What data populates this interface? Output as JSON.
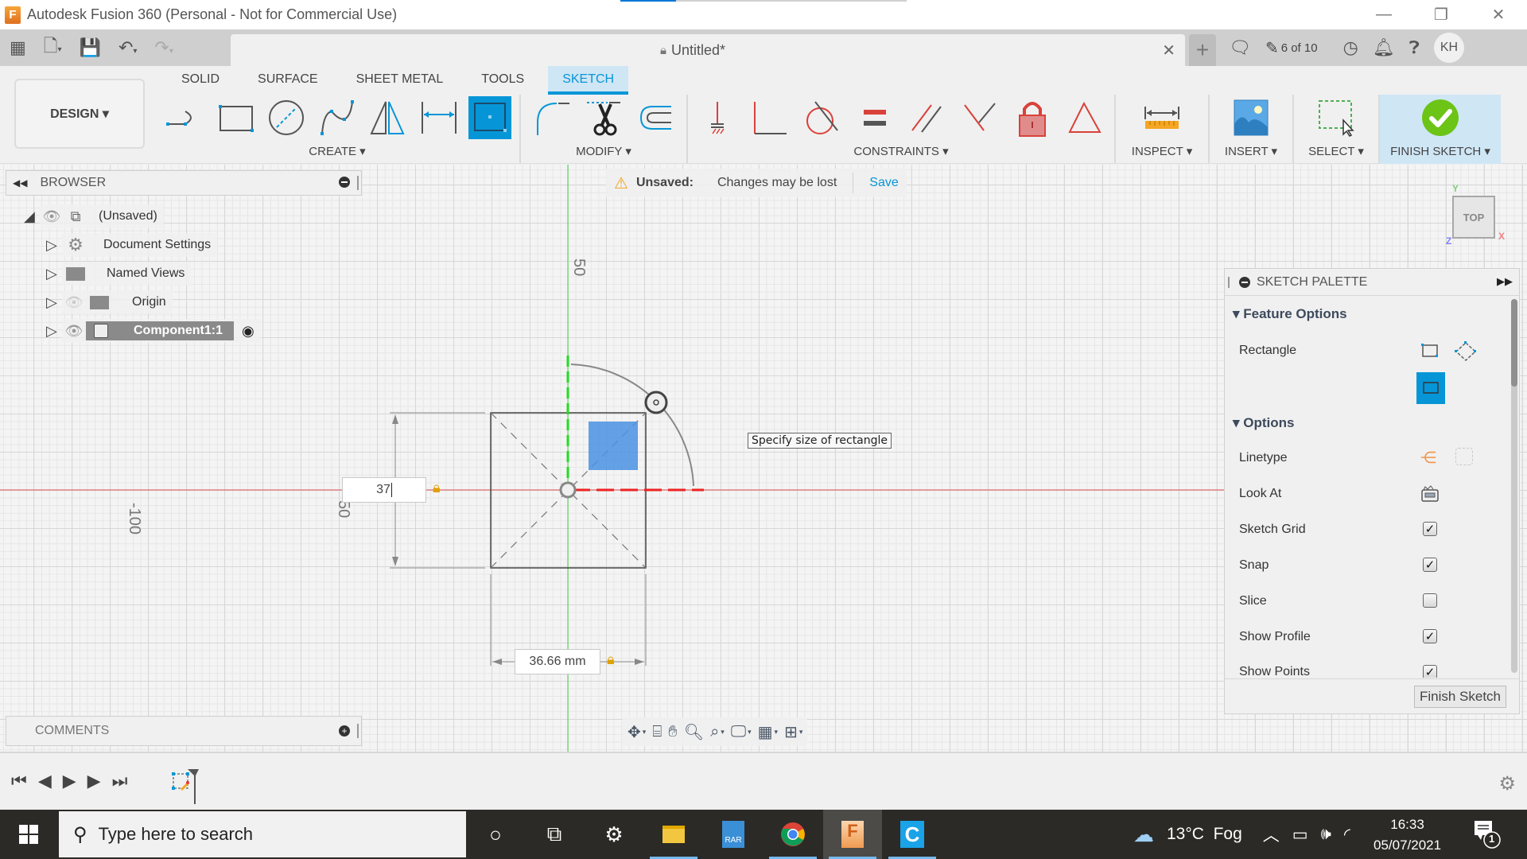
{
  "window": {
    "title": "Autodesk Fusion 360 (Personal - Not for Commercial Use)",
    "app_icon_letter": "F",
    "controls": {
      "minimize": "—",
      "restore": "❐",
      "close": "✕"
    }
  },
  "tabbar": {
    "document_title": "Untitled*",
    "close_label": "✕",
    "new_tab_label": "+",
    "jobs_status": "6 of 10",
    "user_initials": "KH"
  },
  "ribbon": {
    "workspace": "DESIGN ▾",
    "tabs": [
      {
        "label": "SOLID",
        "active": false
      },
      {
        "label": "SURFACE",
        "active": false
      },
      {
        "label": "SHEET METAL",
        "active": false
      },
      {
        "label": "TOOLS",
        "active": false
      },
      {
        "label": "SKETCH",
        "active": true
      }
    ],
    "groups": {
      "create": "CREATE ▾",
      "modify": "MODIFY ▾",
      "constraints": "CONSTRAINTS ▾",
      "inspect": "INSPECT ▾",
      "insert": "INSERT ▾",
      "select": "SELECT ▾",
      "finish": "FINISH SKETCH ▾"
    },
    "colors": {
      "accent": "#0696d7",
      "active_tab_bg": "#cfe6f5",
      "finish_green": "#6cc417",
      "constraint_red": "#d9423a"
    }
  },
  "browser": {
    "title": "BROWSER",
    "items": [
      {
        "label": "(Unsaved)",
        "type": "root"
      },
      {
        "label": "Document Settings",
        "type": "settings"
      },
      {
        "label": "Named Views",
        "type": "folder"
      },
      {
        "label": "Origin",
        "type": "folder"
      },
      {
        "label": "Component1:1",
        "type": "component",
        "selected": true
      }
    ]
  },
  "banner": {
    "status": "Unsaved:",
    "message": "Changes may be lost",
    "save_label": "Save"
  },
  "canvas": {
    "tooltip": "Specify size of rectangle",
    "height_input_value": "37",
    "width_input_value": "36.66 mm",
    "axis_labels": {
      "y_top": "50",
      "left_x": "-100",
      "left_near": "50"
    },
    "view_cube_face": "TOP",
    "axis_letters": {
      "x": "X",
      "y": "Y",
      "z": "Z"
    }
  },
  "sketch_palette": {
    "title": "SKETCH PALETTE",
    "feature_options_label": "Feature Options",
    "rectangle_label": "Rectangle",
    "options_label": "Options",
    "options": [
      {
        "label": "Linetype",
        "kind": "icons"
      },
      {
        "label": "Look At",
        "kind": "icon"
      },
      {
        "label": "Sketch Grid",
        "kind": "checkbox",
        "checked": true
      },
      {
        "label": "Snap",
        "kind": "checkbox",
        "checked": true
      },
      {
        "label": "Slice",
        "kind": "checkbox",
        "checked": false
      },
      {
        "label": "Show Profile",
        "kind": "checkbox",
        "checked": true
      },
      {
        "label": "Show Points",
        "kind": "checkbox",
        "checked": true
      }
    ],
    "finish_button": "Finish Sketch",
    "checkmark": "✓"
  },
  "comments": {
    "title": "COMMENTS"
  },
  "taskbar": {
    "search_placeholder": "Type here to search",
    "weather": "13°C  Fog",
    "time": "16:33",
    "date": "05/07/2021",
    "notification_count": "1"
  }
}
